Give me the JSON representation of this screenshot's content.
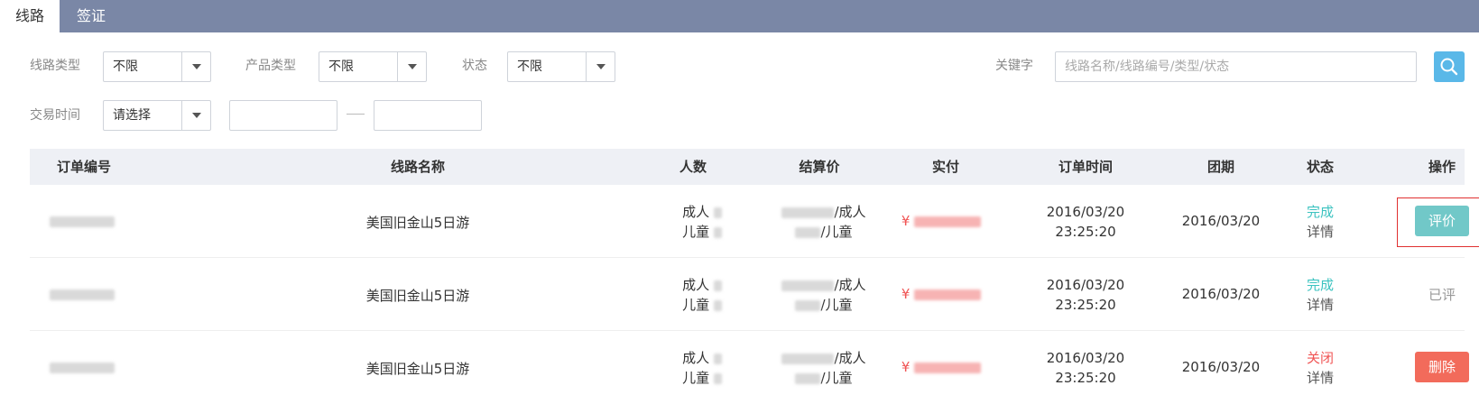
{
  "tabs": [
    {
      "label": "线路",
      "active": true
    },
    {
      "label": "签证",
      "active": false
    }
  ],
  "filters": {
    "route_type": {
      "label": "线路类型",
      "value": "不限"
    },
    "product_type": {
      "label": "产品类型",
      "value": "不限"
    },
    "status": {
      "label": "状态",
      "value": "不限"
    },
    "keyword": {
      "label": "关键字",
      "placeholder": "线路名称/线路编号/类型/状态",
      "value": ""
    },
    "trade_time": {
      "label": "交易时间",
      "value": "请选择",
      "start": "",
      "end": ""
    }
  },
  "table": {
    "headers": [
      "订单编号",
      "线路名称",
      "人数",
      "结算价",
      "实付",
      "订单时间",
      "团期",
      "状态",
      "操作"
    ],
    "rows": [
      {
        "route": "美国旧金山5日游",
        "adult_label": "成人",
        "child_label": "儿童",
        "adult_price_suffix": "/成人",
        "child_price_suffix": "/儿童",
        "currency": "¥",
        "order_date": "2016/03/20",
        "order_time": "23:25:20",
        "tour_date": "2016/03/20",
        "status": "完成",
        "status_type": "done",
        "detail": "详情",
        "action": "评价",
        "action_type": "rate"
      },
      {
        "route": "美国旧金山5日游",
        "adult_label": "成人",
        "child_label": "儿童",
        "adult_price_suffix": "/成人",
        "child_price_suffix": "/儿童",
        "currency": "¥",
        "order_date": "2016/03/20",
        "order_time": "23:25:20",
        "tour_date": "2016/03/20",
        "status": "完成",
        "status_type": "done",
        "detail": "详情",
        "action": "已评",
        "action_type": "rated"
      },
      {
        "route": "美国旧金山5日游",
        "adult_label": "成人",
        "child_label": "儿童",
        "adult_price_suffix": "/成人",
        "child_price_suffix": "/儿童",
        "currency": "¥",
        "order_date": "2016/03/20",
        "order_time": "23:25:20",
        "tour_date": "2016/03/20",
        "status": "关闭",
        "status_type": "closed",
        "detail": "详情",
        "action": "删除",
        "action_type": "delete"
      }
    ]
  },
  "colors": {
    "tabbar": "#7a87a6",
    "accent_teal": "#3cc3c0",
    "rate_button": "#71c8c8",
    "delete_button": "#f26b5b",
    "price_red": "#f05454",
    "search_button": "#5ab8e8"
  },
  "icons": {
    "search": "search-icon",
    "dropdown": "chevron-down-icon"
  }
}
